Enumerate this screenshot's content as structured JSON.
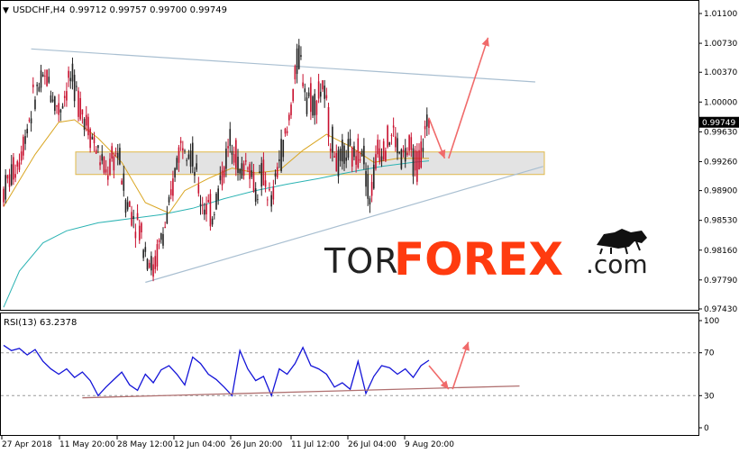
{
  "header": {
    "symbol": "USDCHF,H4",
    "ohlc": "0.99712 0.99757 0.99700 0.99749",
    "arrow": "▼"
  },
  "rsi_header": "RSI(13) 63.2378",
  "watermark": {
    "prefix": "TOR",
    "main": "FOREX",
    "suffix": ".com",
    "colors": {
      "prefix": "#222222",
      "main": "#ff3b0f",
      "suffix": "#222222"
    }
  },
  "colors": {
    "bull_candle": "#222222",
    "bear_candle": "#c8102e",
    "ma_fast": "#d9a520",
    "ma_slow": "#2bb3b3",
    "trendline": "#a9bfd1",
    "zone_fill": "#d9d9d9",
    "zone_border": "#e0b84a",
    "arrow": "#f06a6a",
    "rsi_line": "#1414d8",
    "rsi_support": "#b07070"
  },
  "chart_data": [
    {
      "type": "candlestick",
      "series_name": "USDCHF,H4",
      "ylim": [
        0.9743,
        1.011
      ],
      "yticks": [
        "1.01100",
        "1.00730",
        "1.00370",
        "1.00000",
        "0.99630",
        "0.99260",
        "0.98900",
        "0.98530",
        "0.98160",
        "0.97790",
        "0.97430"
      ],
      "ytick_values": [
        1.011,
        1.0073,
        1.0037,
        1.0,
        0.9963,
        0.9926,
        0.989,
        0.9853,
        0.9816,
        0.9779,
        0.9743
      ],
      "xticks": [
        "27 Apr 2018",
        "11 May 20:00",
        "28 May 12:00",
        "12 Jun 04:00",
        "26 Jun 20:00",
        "11 Jul 12:00",
        "26 Jul 04:00",
        "9 Aug 20:00"
      ],
      "last_price": "0.99749",
      "close_path": [
        [
          0,
          0.989
        ],
        [
          4,
          0.993
        ],
        [
          8,
          1.001
        ],
        [
          11,
          1.003
        ],
        [
          14,
          0.999
        ],
        [
          17,
          1.003
        ],
        [
          20,
          0.999
        ],
        [
          23,
          0.995
        ],
        [
          26,
          0.991
        ],
        [
          29,
          0.994
        ],
        [
          31,
          0.988
        ],
        [
          34,
          0.985
        ],
        [
          36,
          0.982
        ],
        [
          38,
          0.979
        ],
        [
          40,
          0.983
        ],
        [
          42,
          0.986
        ],
        [
          44,
          0.993
        ],
        [
          46,
          0.996
        ],
        [
          48,
          0.993
        ],
        [
          50,
          0.988
        ],
        [
          53,
          0.986
        ],
        [
          56,
          0.992
        ],
        [
          58,
          0.996
        ],
        [
          60,
          0.991
        ],
        [
          62,
          0.993
        ],
        [
          64,
          0.989
        ],
        [
          66,
          0.991
        ],
        [
          68,
          0.987
        ],
        [
          70,
          0.993
        ],
        [
          72,
          0.996
        ],
        [
          74,
          1.003
        ],
        [
          75,
          1.006
        ],
        [
          77,
          1.001
        ],
        [
          79,
          1.0
        ],
        [
          81,
          1.002
        ],
        [
          83,
          0.996
        ],
        [
          85,
          0.992
        ],
        [
          87,
          0.994
        ],
        [
          89,
          0.993
        ],
        [
          91,
          0.995
        ],
        [
          93,
          0.988
        ],
        [
          95,
          0.994
        ],
        [
          97,
          0.995
        ],
        [
          99,
          0.996
        ],
        [
          101,
          0.993
        ],
        [
          103,
          0.994
        ],
        [
          105,
          0.992
        ],
        [
          107,
          0.996
        ],
        [
          108,
          0.99749
        ]
      ],
      "ma_fast": [
        [
          0,
          0.987
        ],
        [
          8,
          0.9935
        ],
        [
          14,
          0.9975
        ],
        [
          18,
          0.9978
        ],
        [
          24,
          0.9955
        ],
        [
          30,
          0.9925
        ],
        [
          36,
          0.9875
        ],
        [
          42,
          0.9862
        ],
        [
          46,
          0.989
        ],
        [
          52,
          0.9905
        ],
        [
          58,
          0.9918
        ],
        [
          64,
          0.9912
        ],
        [
          70,
          0.9915
        ],
        [
          76,
          0.994
        ],
        [
          82,
          0.996
        ],
        [
          88,
          0.9945
        ],
        [
          94,
          0.9925
        ],
        [
          100,
          0.993
        ],
        [
          108,
          0.993
        ]
      ],
      "ma_slow": [
        [
          0,
          0.9745
        ],
        [
          4,
          0.979
        ],
        [
          10,
          0.9825
        ],
        [
          16,
          0.984
        ],
        [
          24,
          0.985
        ],
        [
          32,
          0.9855
        ],
        [
          40,
          0.986
        ],
        [
          48,
          0.9868
        ],
        [
          56,
          0.988
        ],
        [
          64,
          0.989
        ],
        [
          72,
          0.9898
        ],
        [
          80,
          0.9905
        ],
        [
          88,
          0.9913
        ],
        [
          96,
          0.992
        ],
        [
          104,
          0.9925
        ],
        [
          108,
          0.9927
        ]
      ],
      "zone": [
        0.991,
        0.9938
      ],
      "trendline_upper": [
        [
          7,
          1.0066
        ],
        [
          135,
          1.0025
        ]
      ],
      "trendline_lower": [
        [
          36,
          0.9776
        ],
        [
          137,
          0.992
        ]
      ],
      "forecast_arrows": [
        [
          [
            108,
            0.998
          ],
          [
            112,
            0.993
          ]
        ],
        [
          [
            113,
            0.993
          ],
          [
            123,
            1.008
          ]
        ]
      ]
    },
    {
      "type": "line",
      "series_name": "RSI(13)",
      "value": 63.2378,
      "ylim": [
        0,
        100
      ],
      "yticks": [
        "100",
        "70",
        "30",
        "0"
      ],
      "ytick_values": [
        100,
        70,
        30,
        0
      ],
      "dashed_levels": [
        70,
        30
      ],
      "path": [
        [
          0,
          77
        ],
        [
          2,
          72
        ],
        [
          4,
          74
        ],
        [
          6,
          68
        ],
        [
          8,
          73
        ],
        [
          10,
          62
        ],
        [
          12,
          55
        ],
        [
          14,
          50
        ],
        [
          16,
          55
        ],
        [
          18,
          47
        ],
        [
          20,
          52
        ],
        [
          22,
          44
        ],
        [
          24,
          30
        ],
        [
          26,
          38
        ],
        [
          28,
          45
        ],
        [
          30,
          52
        ],
        [
          32,
          40
        ],
        [
          34,
          35
        ],
        [
          36,
          50
        ],
        [
          38,
          42
        ],
        [
          40,
          54
        ],
        [
          42,
          58
        ],
        [
          44,
          50
        ],
        [
          46,
          40
        ],
        [
          48,
          66
        ],
        [
          50,
          60
        ],
        [
          52,
          50
        ],
        [
          54,
          45
        ],
        [
          56,
          38
        ],
        [
          58,
          30
        ],
        [
          60,
          72
        ],
        [
          62,
          55
        ],
        [
          64,
          44
        ],
        [
          66,
          48
        ],
        [
          68,
          30
        ],
        [
          70,
          55
        ],
        [
          72,
          50
        ],
        [
          74,
          60
        ],
        [
          76,
          75
        ],
        [
          78,
          58
        ],
        [
          80,
          55
        ],
        [
          82,
          50
        ],
        [
          84,
          38
        ],
        [
          86,
          42
        ],
        [
          88,
          36
        ],
        [
          90,
          62
        ],
        [
          92,
          32
        ],
        [
          94,
          48
        ],
        [
          96,
          58
        ],
        [
          98,
          56
        ],
        [
          100,
          50
        ],
        [
          102,
          55
        ],
        [
          104,
          47
        ],
        [
          106,
          58
        ],
        [
          108,
          63
        ]
      ],
      "support_line": [
        [
          20,
          28
        ],
        [
          131,
          39
        ]
      ],
      "forecast_arrows": [
        [
          [
            108,
            58
          ],
          [
            113,
            36
          ]
        ],
        [
          [
            114,
            36
          ],
          [
            118,
            80
          ]
        ]
      ]
    }
  ]
}
